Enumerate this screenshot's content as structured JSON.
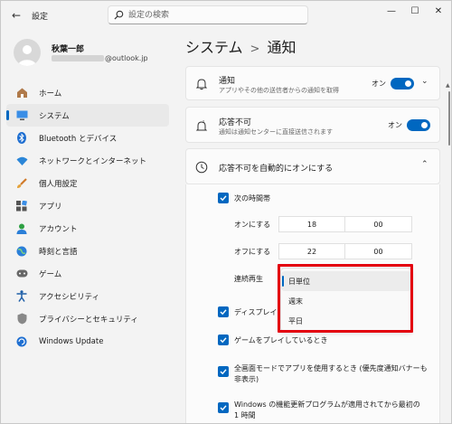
{
  "app": {
    "title": "設定",
    "back_glyph": "←",
    "search_placeholder": "設定の検索",
    "controls": {
      "minimize": "—",
      "maximize": "☐",
      "close": "✕"
    }
  },
  "user": {
    "name": "秋葉一郎",
    "email_suffix": "@outlook.jp"
  },
  "sidebar": {
    "items": [
      {
        "label": "ホーム",
        "icon": "home-icon",
        "active": false
      },
      {
        "label": "システム",
        "icon": "system-icon",
        "active": true
      },
      {
        "label": "Bluetooth とデバイス",
        "icon": "bluetooth-icon",
        "active": false
      },
      {
        "label": "ネットワークとインターネット",
        "icon": "network-icon",
        "active": false
      },
      {
        "label": "個人用設定",
        "icon": "brush-icon",
        "active": false
      },
      {
        "label": "アプリ",
        "icon": "apps-icon",
        "active": false
      },
      {
        "label": "アカウント",
        "icon": "account-icon",
        "active": false
      },
      {
        "label": "時刻と言語",
        "icon": "globe-icon",
        "active": false
      },
      {
        "label": "ゲーム",
        "icon": "gamepad-icon",
        "active": false
      },
      {
        "label": "アクセシビリティ",
        "icon": "accessibility-icon",
        "active": false
      },
      {
        "label": "プライバシーとセキュリティ",
        "icon": "shield-icon",
        "active": false
      },
      {
        "label": "Windows Update",
        "icon": "update-icon",
        "active": false
      }
    ]
  },
  "page": {
    "crumb_parent": "システム",
    "crumb_sep": ">",
    "crumb_current": "通知"
  },
  "notifications": {
    "title": "通知",
    "desc": "アプリやその他の送信者からの通知を取得",
    "toggle_label": "オン"
  },
  "dnd": {
    "title": "応答不可",
    "desc": "通知は通知センターに直接送信されます",
    "toggle_label": "オン"
  },
  "auto_dnd": {
    "title": "応答不可を自動的にオンにする",
    "time_window_label": "次の時間帯",
    "on_label": "オンにする",
    "on_hour": "18",
    "on_minute": "00",
    "off_label": "オフにする",
    "off_hour": "22",
    "off_minute": "00",
    "repeat_label": "連続再生",
    "repeat_options": [
      "日単位",
      "週末",
      "平日"
    ],
    "repeat_selected": "日単位",
    "options": [
      {
        "label": "ディスプレイを複",
        "line2": ""
      },
      {
        "label": "ゲームをプレイしているとき",
        "line2": ""
      },
      {
        "label": "全画面モードでアプリを使用するとき (優先度通知バナーも",
        "line2": "非表示)"
      },
      {
        "label": "Windows の機能更新プログラムが適用されてから最初の",
        "line2": "1 時間"
      }
    ]
  },
  "colors": {
    "accent": "#0067c0",
    "highlight": "#e3000f"
  }
}
